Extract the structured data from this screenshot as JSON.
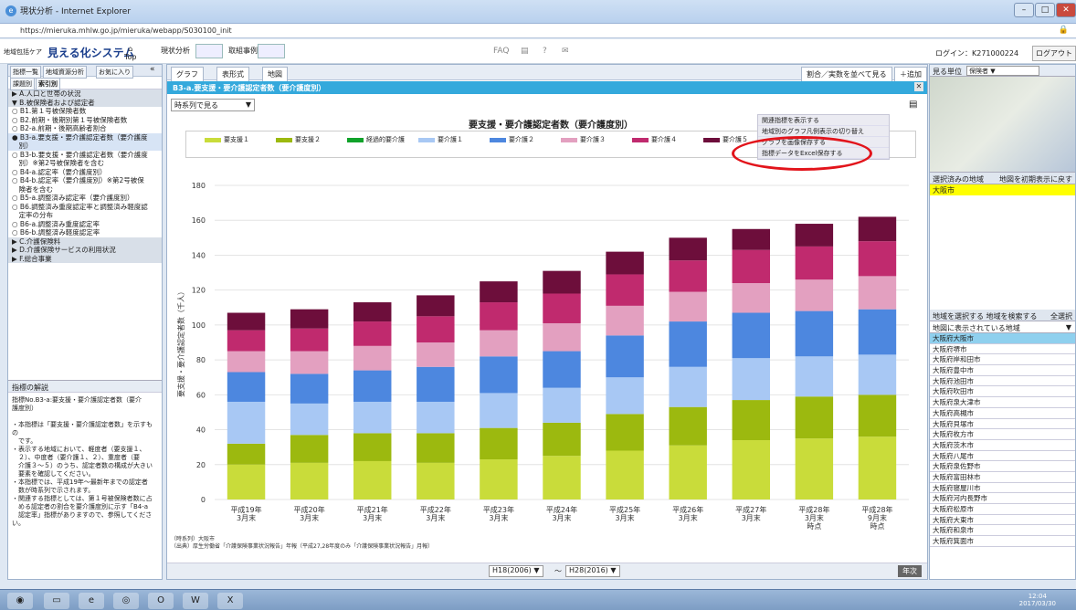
{
  "window": {
    "title": "現状分析 - Internet Explorer",
    "url": "https://mieruka.mhlw.go.jp/mieruka/webapp/S030100_init"
  },
  "header": {
    "sys_small": "地域包括ケア",
    "sys_name": "見える化システム",
    "top": "Top",
    "nav1": "現状分析",
    "nav2": "取組事例",
    "faq": "FAQ",
    "login": "ログイン：K271000224",
    "logout": "ログアウト"
  },
  "left": {
    "tabs": [
      "指標一覧",
      "地域資源分析",
      "お気に入り"
    ],
    "subtabs": [
      "課題別",
      "索引別"
    ],
    "items": [
      {
        "t": "▶ A.人口と世帯の状況",
        "c": "hdr"
      },
      {
        "t": "▼ B.被保険者および認定者",
        "c": "hdr"
      },
      {
        "t": "○ B1.第１号被保険者数",
        "c": ""
      },
      {
        "t": "○ B2.前期・後期別第１号被保険者数",
        "c": ""
      },
      {
        "t": "○ B2-a.前期・後期高齢者割合",
        "c": ""
      },
      {
        "t": "● B3-a.要支援・要介護認定者数（要介護度",
        "c": "sel"
      },
      {
        "t": "　別）",
        "c": "sel"
      },
      {
        "t": "○ B3-b.要支援・要介護認定者数（要介護度",
        "c": ""
      },
      {
        "t": "　別）※第2号被保険者を含む",
        "c": ""
      },
      {
        "t": "○ B4-a.認定率（要介護度別）",
        "c": ""
      },
      {
        "t": "○ B4-b.認定率（要介護度別）※第2号被保",
        "c": ""
      },
      {
        "t": "　険者を含む",
        "c": ""
      },
      {
        "t": "○ B5-a.調整済み認定率（要介護度別）",
        "c": ""
      },
      {
        "t": "○ B6.調整済み重度認定率と調整済み軽度認",
        "c": ""
      },
      {
        "t": "　定率の分布",
        "c": ""
      },
      {
        "t": "○ B6-a.調整済み重度認定率",
        "c": ""
      },
      {
        "t": "○ B6-b.調整済み軽度認定率",
        "c": ""
      },
      {
        "t": "▶ C.介護保険料",
        "c": "hdr"
      },
      {
        "t": "▶ D.介護保険サービスの利用状況",
        "c": "hdr"
      },
      {
        "t": "▶ F.総合事業",
        "c": "hdr"
      }
    ],
    "comment_title": "指標の解説",
    "comment_lines": [
      "指標No.B3-a:要支援・要介護認定者数（要介",
      "護度別）",
      "",
      "・本指標は「要支援・要介護認定者数」を示すもの",
      "　です。",
      "・表示する地域において、軽度者（要支援１、",
      "　２）、中度者（要介護１、２）、重度者（要",
      "　介護３～５）のうち、認定者数の構成が大きい",
      "　要素を確認してください。",
      "・本指標では、平成19年～最新年までの認定者",
      "　数が時系列で示されます。",
      "・関連する指標としては、第１号被保険者数に占",
      "　める認定者の割合を要介護度別に示す「B4-a",
      "　認定率」指標がありますので、参照してください。"
    ]
  },
  "main": {
    "tabs": [
      "グラフ",
      "表形式",
      "地図"
    ],
    "right_btn": "割合／実数を並べて見る",
    "add": "＋追加",
    "bar": "B3-a.要支援・要介護認定者数（要介護度別）",
    "view": "時系列で見る",
    "menu": [
      "関連指標を表示する",
      "地域別のグラフ凡例表示の切り替え",
      "グラフを画像保存する",
      "指標データをExcel保存する"
    ],
    "source1": "（時系列）大阪市",
    "source2": "（出典）厚生労働省「介護保険事業状況報告」年報（平成27,28年度のみ「介護保険事業状況報告」月報）",
    "from": "H18(2006)",
    "to": "H28(2016)",
    "nendo": "年次"
  },
  "chart_data": {
    "type": "bar",
    "stacked": true,
    "title": "要支援・要介護認定者数（要介護度別）",
    "ylabel": "要支援・要介護認定者数（千人）",
    "ylim": [
      0,
      180
    ],
    "yticks": [
      0,
      20,
      40,
      60,
      80,
      100,
      120,
      140,
      160,
      180
    ],
    "categories": [
      [
        "平成19年",
        "3月末"
      ],
      [
        "平成20年",
        "3月末"
      ],
      [
        "平成21年",
        "3月末"
      ],
      [
        "平成22年",
        "3月末"
      ],
      [
        "平成23年",
        "3月末"
      ],
      [
        "平成24年",
        "3月末"
      ],
      [
        "平成25年",
        "3月末"
      ],
      [
        "平成26年",
        "3月末"
      ],
      [
        "平成27年",
        "3月末"
      ],
      [
        "平成28年",
        "3月末",
        "時点"
      ],
      [
        "平成28年",
        "9月末",
        "時点"
      ]
    ],
    "series": [
      {
        "name": "要支援１",
        "color": "#c9dc3a",
        "values": [
          20,
          21,
          22,
          21,
          23,
          25,
          28,
          31,
          34,
          35,
          36
        ]
      },
      {
        "name": "要支援２",
        "color": "#9cb90f",
        "values": [
          12,
          16,
          16,
          17,
          18,
          19,
          21,
          22,
          23,
          24,
          24
        ]
      },
      {
        "name": "経過的要介護",
        "color": "#10a22a",
        "values": [
          0,
          0,
          0,
          0,
          0,
          0,
          0,
          0,
          0,
          0,
          0
        ]
      },
      {
        "name": "要介護１",
        "color": "#a8c8f4",
        "values": [
          24,
          18,
          18,
          18,
          20,
          20,
          21,
          23,
          24,
          23,
          23
        ]
      },
      {
        "name": "要介護２",
        "color": "#4d87df",
        "values": [
          17,
          17,
          18,
          20,
          21,
          21,
          24,
          26,
          26,
          26,
          26
        ]
      },
      {
        "name": "要介護３",
        "color": "#e3a0c0",
        "values": [
          12,
          13,
          14,
          14,
          15,
          16,
          17,
          17,
          17,
          18,
          19
        ]
      },
      {
        "name": "要介護４",
        "color": "#c02a6e",
        "values": [
          12,
          13,
          14,
          15,
          16,
          17,
          18,
          18,
          19,
          19,
          20
        ]
      },
      {
        "name": "要介護５",
        "color": "#6d0e3b",
        "values": [
          10,
          11,
          11,
          12,
          12,
          13,
          13,
          13,
          12,
          13,
          14
        ]
      }
    ]
  },
  "right": {
    "unit_label": "見る単位",
    "unit": "保険者",
    "selected_head": "選択済みの地域",
    "reset": "地図を初期表示に戻す",
    "selected": "大阪市",
    "tab1": "地域を選択する",
    "tab2": "地域を検索する",
    "all": "全選択",
    "filter": "地図に表示されている地域",
    "cities": [
      "大阪府大阪市",
      "大阪府堺市",
      "大阪府岸和田市",
      "大阪府豊中市",
      "大阪府池田市",
      "大阪府吹田市",
      "大阪府泉大津市",
      "大阪府高槻市",
      "大阪府貝塚市",
      "大阪府枚方市",
      "大阪府茨木市",
      "大阪府八尾市",
      "大阪府泉佐野市",
      "大阪府富田林市",
      "大阪府寝屋川市",
      "大阪府河内長野市",
      "大阪府松原市",
      "大阪府大東市",
      "大阪府和泉市",
      "大阪府箕面市"
    ]
  },
  "taskbar": {
    "time": "12:04",
    "date": "2017/03/30"
  }
}
